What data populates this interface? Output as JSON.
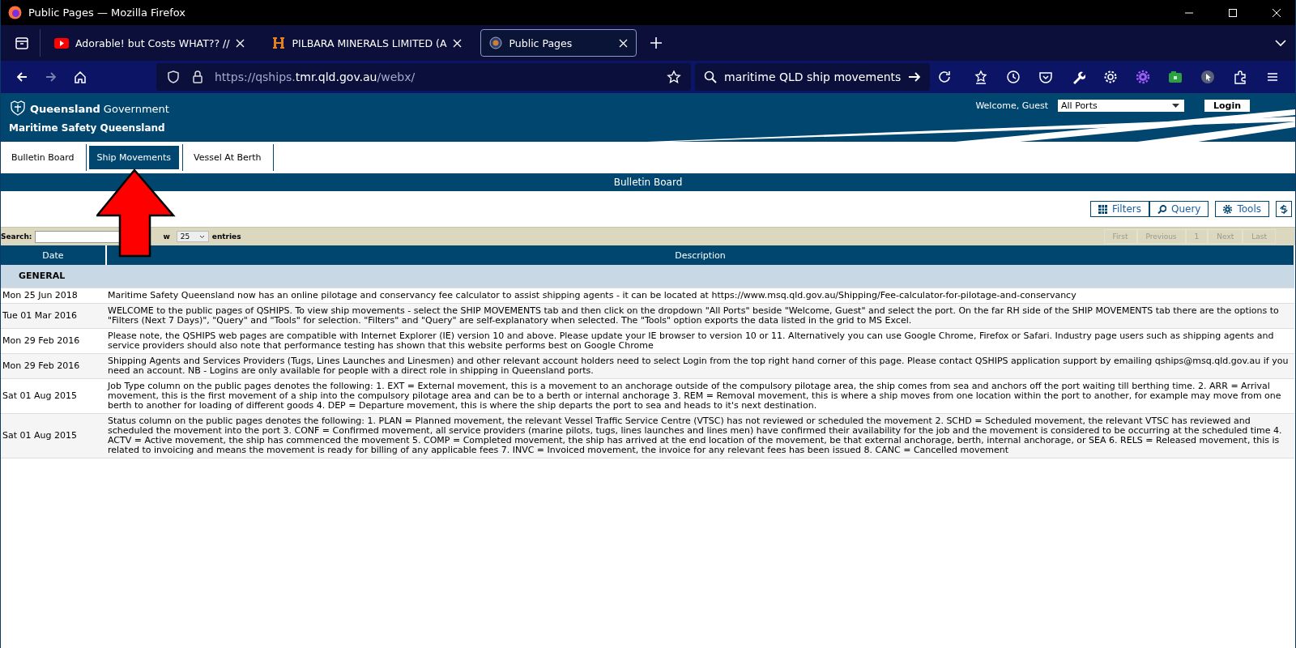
{
  "browser": {
    "window_title": "Public Pages — Mozilla Firefox",
    "tabs": [
      {
        "title": "Adorable! but Costs WHAT?? // ",
        "kind": "video",
        "selected": false
      },
      {
        "title": "PILBARA MINERALS LIMITED (A",
        "kind": "letter",
        "selected": false
      },
      {
        "title": "Public Pages",
        "kind": "crest",
        "selected": true
      }
    ],
    "url_parts": [
      {
        "text": "https://qships.",
        "dim": true
      },
      {
        "text": "tmr.qld.gov.au",
        "dim": false
      },
      {
        "text": "/webx/",
        "dim": true
      }
    ],
    "search_value": "maritime QLD ship movements"
  },
  "site": {
    "brand": "**Queensland** Government",
    "subtitle": "Maritime Safety Queensland",
    "welcome": "Welcome, Guest",
    "port_select": "All Ports",
    "login": "Login",
    "tabs": [
      {
        "label": "Bulletin Board",
        "selected": false
      },
      {
        "label": "Ship Movements",
        "selected": true
      },
      {
        "label": "Vessel At Berth",
        "selected": false
      }
    ]
  },
  "bulletin": {
    "title": "Bulletin Board",
    "toolbar": [
      {
        "label": "Filters",
        "kind": "grid"
      },
      {
        "label": "Query",
        "kind": "search"
      },
      {
        "label": "Tools",
        "kind": "gear"
      }
    ],
    "search_label": "Search:",
    "show_label": "w",
    "page_size": "25",
    "entries_label": "entries",
    "pagination": [
      {
        "label": "First",
        "disabled": true
      },
      {
        "label": "Previous",
        "disabled": true
      },
      {
        "label": "1",
        "disabled": true
      },
      {
        "label": "Next",
        "disabled": true
      },
      {
        "label": "Last",
        "disabled": true
      }
    ],
    "columns": [
      "Date",
      "Description"
    ],
    "group": "GENERAL",
    "rows": [
      {
        "date": "Mon 25 Jun 2018",
        "description": "Maritime Safety Queensland now has an online pilotage and conservancy fee calculator to assist shipping agents - it can be located at https://www.msq.qld.gov.au/Shipping/Fee-calculator-for-pilotage-and-conservancy"
      },
      {
        "date": "Tue 01 Mar 2016",
        "description": "WELCOME to the public pages of QSHIPS. To view ship movements - select the SHIP MOVEMENTS tab and then click on the dropdown \"All Ports\" beside \"Welcome, Guest\" and select the port. On the far RH side of the SHIP MOVEMENTS tab there are the options to \"Filters (Next 7 Days)\", \"Query\" and \"Tools\" for selection. \"Filters\" and \"Query\" are self-explanatory when selected. The \"Tools\" option exports the data listed in the grid to MS Excel."
      },
      {
        "date": "Mon 29 Feb 2016",
        "description": "Please note, the QSHIPS web pages are compatible with Internet Explorer (IE) version 10 and above. Please update your IE browser to version 10 or 11. Alternatively you can use Google Chrome, Firefox or Safari. Industry page users such as shipping agents and service providers should also note that performance testing has shown that this website performs best on Google Chrome"
      },
      {
        "date": "Mon 29 Feb 2016",
        "description": "Shipping Agents and Services Providers (Tugs, Lines Launches and Linesmen) and other relevant account holders need to select Login from the top right hand corner of this page. Please contact QSHIPS application support by emailing qships@msq.qld.gov.au if you need an account. NB - Logins are only available for people with a direct role in shipping in Queensland ports."
      },
      {
        "date": "Sat 01 Aug 2015",
        "description": "Job Type column on the public pages denotes the following: 1. EXT = External movement, this is a movement to an anchorage outside of the compulsory pilotage area, the ship comes from sea and anchors off the port waiting till berthing time. 2. ARR = Arrival movement, this is the first movement of a ship into the compulsory pilotage area and can be to a berth or internal anchorage 3. REM = Removal movement, this is where a ship moves from one location within the port to another, for example may move from one berth to another for loading of different goods 4. DEP = Departure movement, this is where the ship departs the port to sea and heads to it's next destination."
      },
      {
        "date": "Sat 01 Aug 2015",
        "description": "Status column on the public pages denotes the following: 1. PLAN = Planned movement, the relevant Vessel Traffic Service Centre (VTSC) has not reviewed or scheduled the movement 2. SCHD = Scheduled movement, the relevant VTSC has reviewed and scheduled the movement into the port 3. CONF = Confirmed movement, all service providers (marine pilots, tugs, lines launches and lines men) have confirmed their availability for the job and the movement is considered to be occurring at the scheduled time 4. ACTV = Active movement, the ship has commenced the movement 5. COMP = Completed movement, the ship has arrived at the end location of the movement, be that external anchorage, berth, internal anchorage, or SEA 6. RELS = Released movement, this is related to invoicing and means the movement is ready for billing of any applicable fees 7. INVC = Invoiced movement, the invoice for any relevant fees has been issued 8. CANC = Cancelled movement"
      }
    ]
  }
}
